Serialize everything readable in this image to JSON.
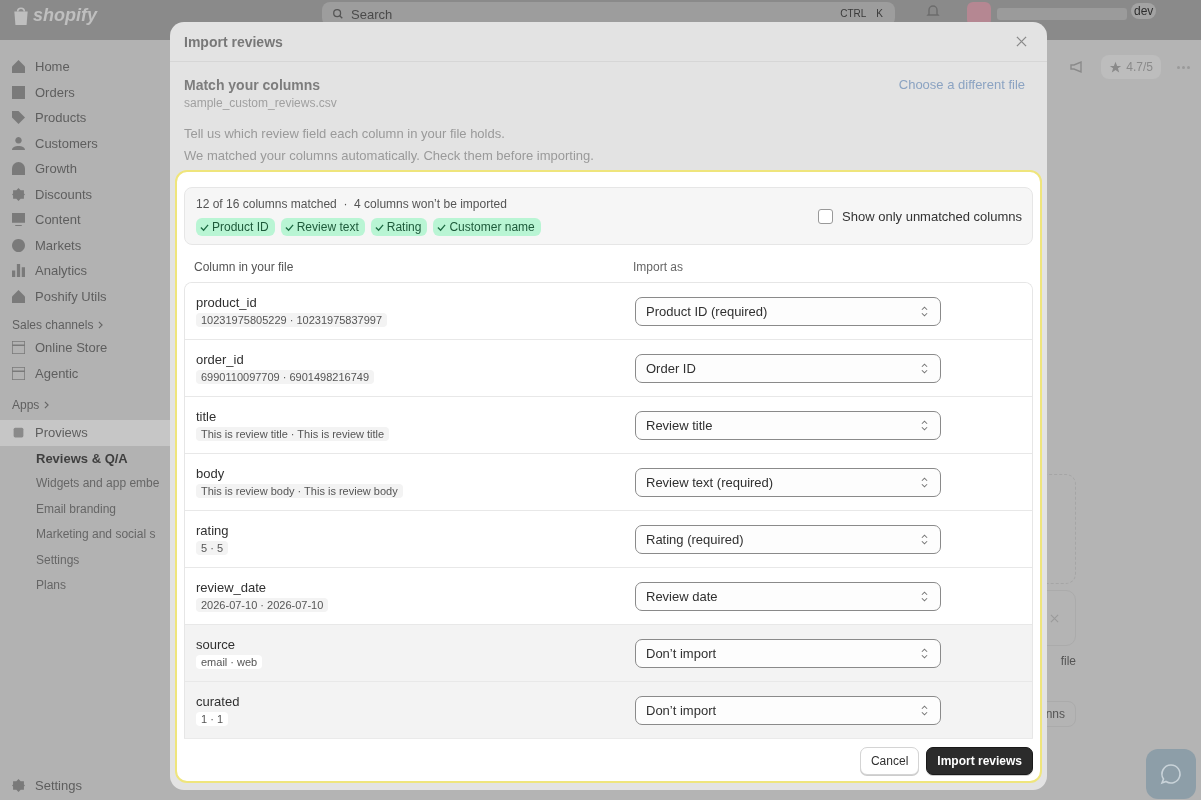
{
  "topbar": {
    "logo": "shopify",
    "search": {
      "placeholder": "Search",
      "shortcut": [
        "CTRL",
        "K"
      ]
    },
    "store_chip": "dev"
  },
  "sidebar": {
    "items": [
      {
        "label": "Home"
      },
      {
        "label": "Orders"
      },
      {
        "label": "Products"
      },
      {
        "label": "Customers"
      },
      {
        "label": "Growth"
      },
      {
        "label": "Discounts"
      },
      {
        "label": "Content"
      },
      {
        "label": "Markets"
      },
      {
        "label": "Analytics"
      },
      {
        "label": "Poshify Utils"
      }
    ],
    "sales_channels": {
      "heading": "Sales channels",
      "items": [
        {
          "label": "Online Store"
        },
        {
          "label": "Agentic"
        }
      ]
    },
    "apps_heading": "Apps",
    "app": {
      "label": "Proviews",
      "selected": true,
      "children": [
        {
          "label": "Reviews & Q/A",
          "selected": true
        },
        {
          "label": "Widgets and app embe",
          "selected": false
        },
        {
          "label": "Email branding",
          "selected": false
        },
        {
          "label": "Marketing and social s",
          "selected": false
        },
        {
          "label": "Settings",
          "selected": false
        },
        {
          "label": "Plans",
          "selected": false
        }
      ]
    },
    "footer": {
      "label": "Settings"
    }
  },
  "page_behind": {
    "rating_button": "4.7/5",
    "fragments": [
      "file",
      "nns"
    ]
  },
  "modal": {
    "title": "Import reviews",
    "heading": "Match your columns",
    "filename": "sample_custom_reviews.csv",
    "change_file_link": "Choose a different file",
    "intro": [
      "Tell us which review field each column in your file holds.",
      "We matched your columns automatically. Check them before importing."
    ],
    "summary": {
      "text": "12 of 16 columns matched  ·  4 columns won’t be imported",
      "chips": [
        "Product ID",
        "Review text",
        "Rating",
        "Customer name"
      ],
      "filter": {
        "label": "Show only unmatched columns",
        "checked": false
      }
    },
    "columns": [
      "Column in your file",
      "Import as"
    ],
    "rows": [
      {
        "column": "product_id",
        "samples": "10231975805229 · 10231975837997",
        "import_as": "Product ID (required)",
        "ignored": false
      },
      {
        "column": "order_id",
        "samples": "6990110097709 · 6901498216749",
        "import_as": "Order ID",
        "ignored": false
      },
      {
        "column": "title",
        "samples": "This is review title · This is review title",
        "import_as": "Review title",
        "ignored": false
      },
      {
        "column": "body",
        "samples": "This is review body · This is review body",
        "import_as": "Review text (required)",
        "ignored": false
      },
      {
        "column": "rating",
        "samples": "5 · 5",
        "import_as": "Rating (required)",
        "ignored": false
      },
      {
        "column": "review_date",
        "samples": "2026-07-10 · 2026-07-10",
        "import_as": "Review date",
        "ignored": false
      },
      {
        "column": "source",
        "samples": "email · web",
        "import_as": "Don’t import",
        "ignored": true
      },
      {
        "column": "curated",
        "samples": "1 · 1",
        "import_as": "Don’t import",
        "ignored": true
      }
    ],
    "buttons": [
      {
        "label": "Cancel",
        "kind": "secondary"
      },
      {
        "label": "Import reviews",
        "kind": "primary"
      }
    ]
  }
}
